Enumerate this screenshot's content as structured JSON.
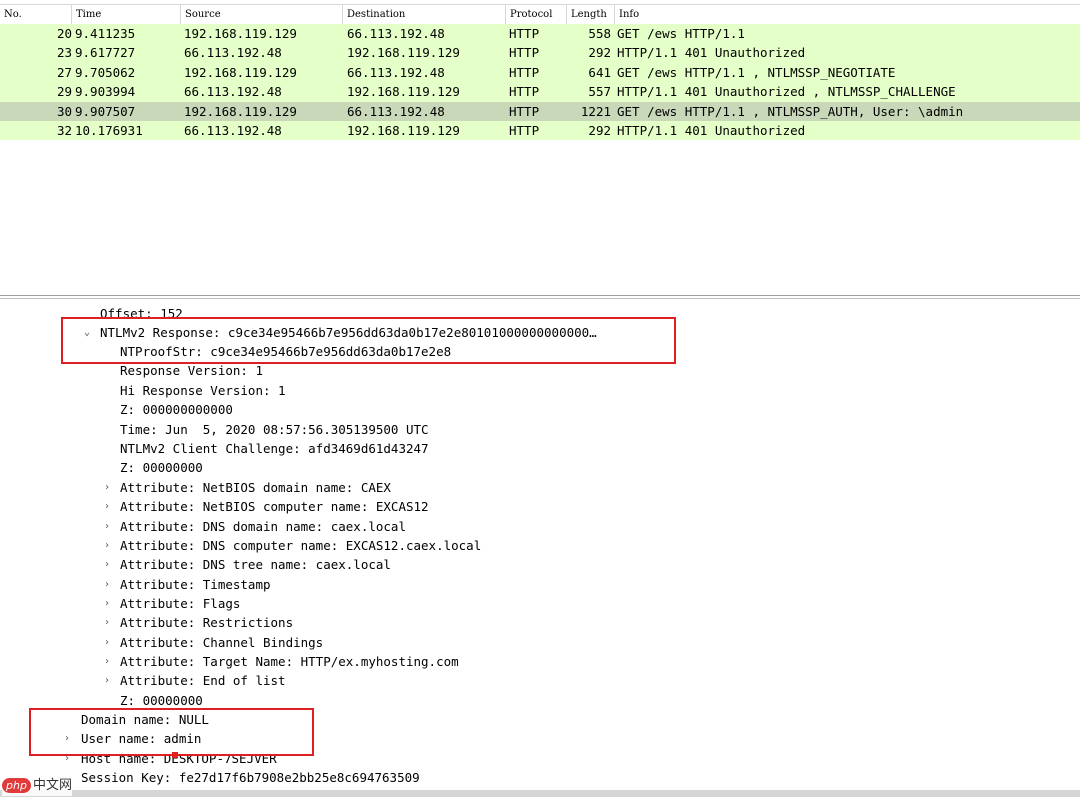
{
  "columns": {
    "no": "No.",
    "time": "Time",
    "source": "Source",
    "destination": "Destination",
    "protocol": "Protocol",
    "length": "Length",
    "info": "Info"
  },
  "packets": [
    {
      "no": "20",
      "time": "9.411235",
      "src": "192.168.119.129",
      "dst": "66.113.192.48",
      "proto": "HTTP",
      "len": "558",
      "info": "GET /ews HTTP/1.1"
    },
    {
      "no": "23",
      "time": "9.617727",
      "src": "66.113.192.48",
      "dst": "192.168.119.129",
      "proto": "HTTP",
      "len": "292",
      "info": "HTTP/1.1 401 Unauthorized"
    },
    {
      "no": "27",
      "time": "9.705062",
      "src": "192.168.119.129",
      "dst": "66.113.192.48",
      "proto": "HTTP",
      "len": "641",
      "info": "GET /ews HTTP/1.1 , NTLMSSP_NEGOTIATE"
    },
    {
      "no": "29",
      "time": "9.903994",
      "src": "66.113.192.48",
      "dst": "192.168.119.129",
      "proto": "HTTP",
      "len": "557",
      "info": "HTTP/1.1 401 Unauthorized , NTLMSSP_CHALLENGE"
    },
    {
      "no": "30",
      "time": "9.907507",
      "src": "192.168.119.129",
      "dst": "66.113.192.48",
      "proto": "HTTP",
      "len": "1221",
      "info": "GET /ews HTTP/1.1 , NTLMSSP_AUTH, User: \\admin"
    },
    {
      "no": "32",
      "time": "10.176931",
      "src": "66.113.192.48",
      "dst": "192.168.119.129",
      "proto": "HTTP",
      "len": "292",
      "info": "HTTP/1.1 401 Unauthorized"
    }
  ],
  "details": {
    "offset": "Offset: 152",
    "ntlmv2_response": "NTLMv2 Response: c9ce34e95466b7e956dd63da0b17e2e80101000000000000…",
    "ntproofstr": "NTProofStr: c9ce34e95466b7e956dd63da0b17e2e8",
    "response_version": "Response Version: 1",
    "hi_response_version": "Hi Response Version: 1",
    "z1": "Z: 000000000000",
    "time": "Time: Jun  5, 2020 08:57:56.305139500 UTC",
    "client_challenge": "NTLMv2 Client Challenge: afd3469d61d43247",
    "z2": "Z: 00000000",
    "attributes": [
      "Attribute: NetBIOS domain name: CAEX",
      "Attribute: NetBIOS computer name: EXCAS12",
      "Attribute: DNS domain name: caex.local",
      "Attribute: DNS computer name: EXCAS12.caex.local",
      "Attribute: DNS tree name: caex.local",
      "Attribute: Timestamp",
      "Attribute: Flags",
      "Attribute: Restrictions",
      "Attribute: Channel Bindings",
      "Attribute: Target Name: HTTP/ex.myhosting.com",
      "Attribute: End of list"
    ],
    "z3": "Z: 00000000",
    "domain_name": "Domain name: NULL",
    "user_name": "User name: admin",
    "host_name": "Host name: DESKTOP-7SEJVER",
    "session_key": "Session Key: fe27d17f6b7908e2bb25e8c694763509"
  },
  "watermark": {
    "badge": "php",
    "text": "中文网"
  },
  "colors": {
    "row_bg": "#e4ffc7",
    "row_selected": "#c8d8b8",
    "highlight": "#e02020"
  }
}
